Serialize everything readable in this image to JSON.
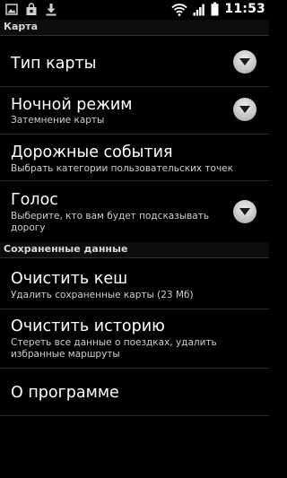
{
  "status_bar": {
    "time": "11:53",
    "left_icons": [
      "gallery-icon",
      "shopping-bag-icon",
      "download-icon"
    ],
    "right_icons": [
      "wifi-icon",
      "signal-icon",
      "battery-icon"
    ]
  },
  "sections": [
    {
      "header": "Карта",
      "items": [
        {
          "title": "Тип карты",
          "summary": "",
          "has_dropdown": true
        },
        {
          "title": "Ночной режим",
          "summary": "Затемнение карты",
          "has_dropdown": true
        },
        {
          "title": "Дорожные события",
          "summary": "Выбрать категории пользовательских точек",
          "has_dropdown": false
        },
        {
          "title": "Голос",
          "summary": "Выберите, кто вам будет подсказывать дорогу",
          "has_dropdown": true
        }
      ]
    },
    {
      "header": "Сохраненные данные",
      "items": [
        {
          "title": "Очистить кеш",
          "summary": "Удалить сохраненные карты (23 Мб)",
          "has_dropdown": false
        },
        {
          "title": "Очистить историю",
          "summary": "Стереть все данные о поездках, удалить избранные маршруты",
          "has_dropdown": false
        },
        {
          "title": "О программе",
          "summary": "",
          "has_dropdown": false
        }
      ]
    }
  ],
  "colors": {
    "background": "#000000",
    "divider": "#2b2b2b",
    "summary_text": "#cfcfcf"
  }
}
